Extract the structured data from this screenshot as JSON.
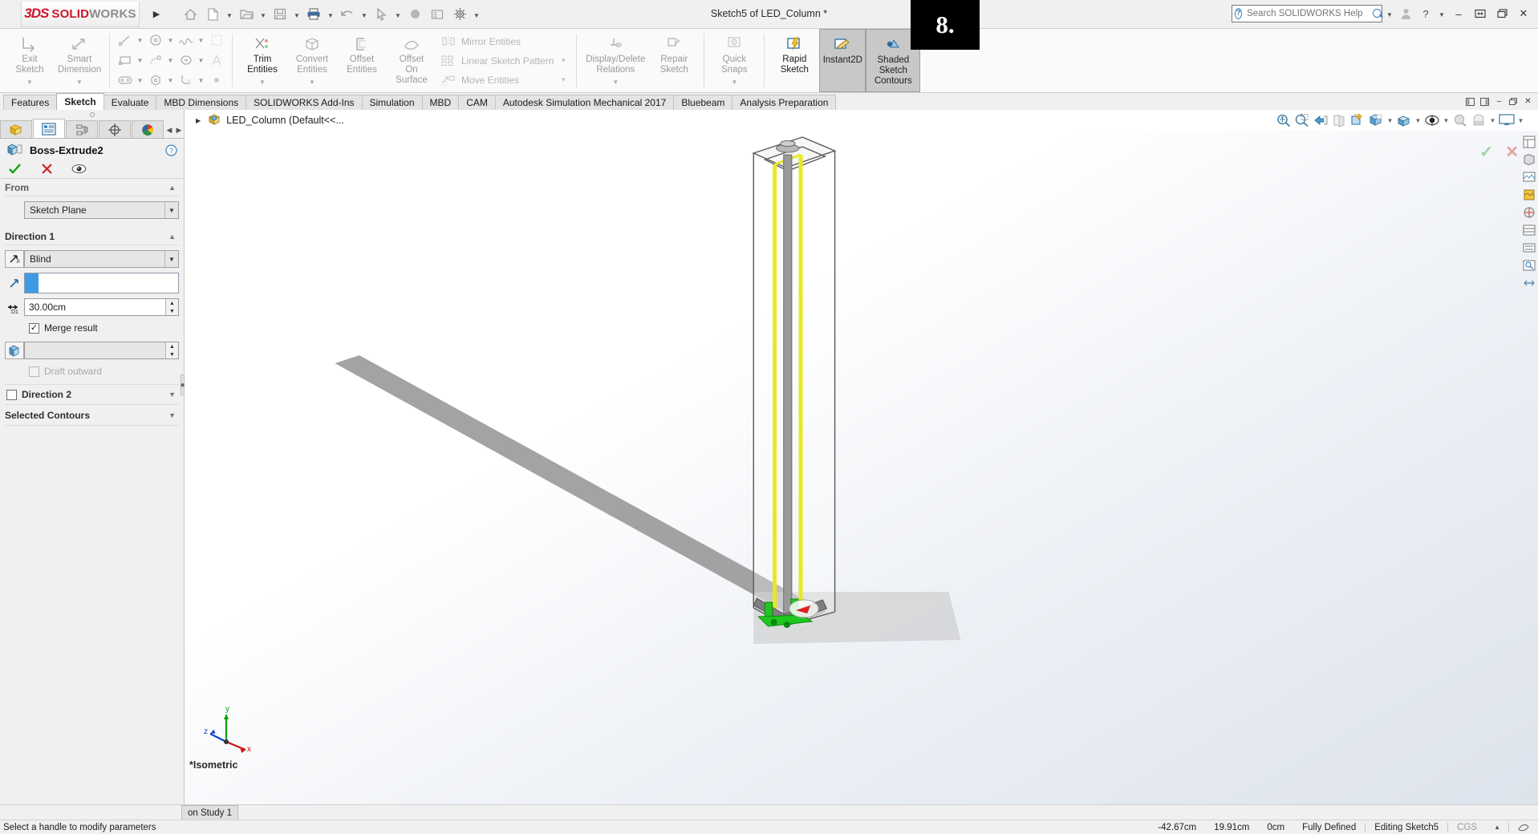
{
  "app": {
    "brand_3ds": "3DS",
    "brand_solid": "SOLID",
    "brand_works": "WORKS",
    "document_title": "Sketch5 of LED_Column *",
    "overlay_badge": "8."
  },
  "search": {
    "placeholder": "Search SOLIDWORKS Help",
    "value": ""
  },
  "quick_access": {
    "items": [
      {
        "name": "home-icon",
        "glyph": "home"
      },
      {
        "name": "new-document-icon",
        "glyph": "doc"
      },
      {
        "name": "open-icon",
        "glyph": "folder"
      },
      {
        "name": "save-icon",
        "glyph": "save"
      },
      {
        "name": "print-icon",
        "glyph": "print"
      },
      {
        "name": "undo-icon",
        "glyph": "undo"
      },
      {
        "name": "select-icon",
        "glyph": "cursor"
      },
      {
        "name": "rebuild-icon",
        "glyph": "rebuild"
      },
      {
        "name": "options-icon",
        "glyph": "gear"
      }
    ]
  },
  "ribbon": {
    "exit_sketch": "Exit\nSketch",
    "exit_sketch_l1": "Exit",
    "exit_sketch_l2": "Sketch",
    "smart_dimension_l1": "Smart",
    "smart_dimension_l2": "Dimension",
    "trim_entities_l1": "Trim",
    "trim_entities_l2": "Entities",
    "convert_entities_l1": "Convert",
    "convert_entities_l2": "Entities",
    "offset_entities_l1": "Offset",
    "offset_entities_l2": "Entities",
    "offset_on_surface_l1": "Offset",
    "offset_on_surface_l2": "On",
    "offset_on_surface_l3": "Surface",
    "mirror_entities": "Mirror Entities",
    "linear_sketch_pattern": "Linear Sketch Pattern",
    "move_entities": "Move Entities",
    "display_delete_relations_l1": "Display/Delete",
    "display_delete_relations_l2": "Relations",
    "repair_sketch_l1": "Repair",
    "repair_sketch_l2": "Sketch",
    "quick_snaps_l1": "Quick",
    "quick_snaps_l2": "Snaps",
    "rapid_sketch_l1": "Rapid",
    "rapid_sketch_l2": "Sketch",
    "instant2d": "Instant2D",
    "shaded_sketch_contours_l1": "Shaded",
    "shaded_sketch_contours_l2": "Sketch",
    "shaded_sketch_contours_l3": "Contours"
  },
  "tabs": {
    "items": [
      {
        "label": "Features",
        "active": false
      },
      {
        "label": "Sketch",
        "active": true
      },
      {
        "label": "Evaluate",
        "active": false
      },
      {
        "label": "MBD Dimensions",
        "active": false
      },
      {
        "label": "SOLIDWORKS Add-Ins",
        "active": false
      },
      {
        "label": "Simulation",
        "active": false
      },
      {
        "label": "MBD",
        "active": false
      },
      {
        "label": "CAM",
        "active": false
      },
      {
        "label": "Autodesk Simulation Mechanical 2017",
        "active": false
      },
      {
        "label": "Bluebeam",
        "active": false
      },
      {
        "label": "Analysis Preparation",
        "active": false
      }
    ]
  },
  "property_manager": {
    "feature_title": "Boss-Extrude2",
    "tabs": [
      {
        "name": "feature-manager-tab",
        "icon": "yellow-block-icon",
        "active": false
      },
      {
        "name": "property-manager-tab",
        "icon": "blue-list-icon",
        "active": true
      },
      {
        "name": "configuration-manager-tab",
        "icon": "config-icon",
        "active": false
      },
      {
        "name": "dimxpert-manager-tab",
        "icon": "crosshair-icon",
        "active": false
      },
      {
        "name": "display-manager-tab",
        "icon": "color-sphere-icon",
        "active": false
      }
    ],
    "from": {
      "header": "From",
      "value": "Sketch Plane"
    },
    "direction1": {
      "header": "Direction 1",
      "end_condition": "Blind",
      "depth": "30.00cm",
      "merge_result_label": "Merge result",
      "merge_result_checked": true,
      "draft_angle": "",
      "draft_outward_label": "Draft outward",
      "draft_outward_checked": false
    },
    "direction2": {
      "header": "Direction 2",
      "checked": false
    },
    "selected_contours": {
      "header": "Selected Contours"
    }
  },
  "graphics": {
    "feature_tree_root": "LED_Column  (Default<<...",
    "view_orientation_label": "*Isometric",
    "axis_x": "x",
    "axis_y": "y",
    "axis_z": "z",
    "view_tools": [
      {
        "name": "zoom-to-fit-icon"
      },
      {
        "name": "zoom-to-area-icon"
      },
      {
        "name": "previous-view-icon"
      },
      {
        "name": "section-view-icon"
      },
      {
        "name": "view-orientation-icon"
      },
      {
        "name": "display-style-icon"
      },
      {
        "name": "hide-show-items-icon"
      },
      {
        "name": "edit-appearance-icon"
      },
      {
        "name": "apply-scene-icon"
      },
      {
        "name": "view-settings-icon"
      }
    ],
    "right_dock": [
      {
        "name": "view-palette-icon"
      },
      {
        "name": "appearances-icon"
      },
      {
        "name": "scenes-icon"
      },
      {
        "name": "decals-icon"
      },
      {
        "name": "custom-properties-icon"
      },
      {
        "name": "design-library-icon"
      },
      {
        "name": "file-explorer-icon"
      },
      {
        "name": "search-library-icon"
      },
      {
        "name": "drag-resize-icon"
      }
    ]
  },
  "bottom_tabs": {
    "items": [
      {
        "label": "on Study 1"
      }
    ]
  },
  "status_bar": {
    "message": "Select a handle to modify parameters",
    "coord_x": "-42.67cm",
    "coord_y": "19.91cm",
    "coord_z": "0cm",
    "sketch_state": "Fully Defined",
    "editing": "Editing Sketch5",
    "units": "CGS"
  },
  "colors": {
    "brand_red": "#d1132a",
    "accent_blue": "#3f9ae5",
    "highlight_yellow": "#e8e82a",
    "selection_green": "#1ec81e",
    "tab_active_bg": "#ffffff",
    "panel_bg": "#f0f0f0"
  }
}
